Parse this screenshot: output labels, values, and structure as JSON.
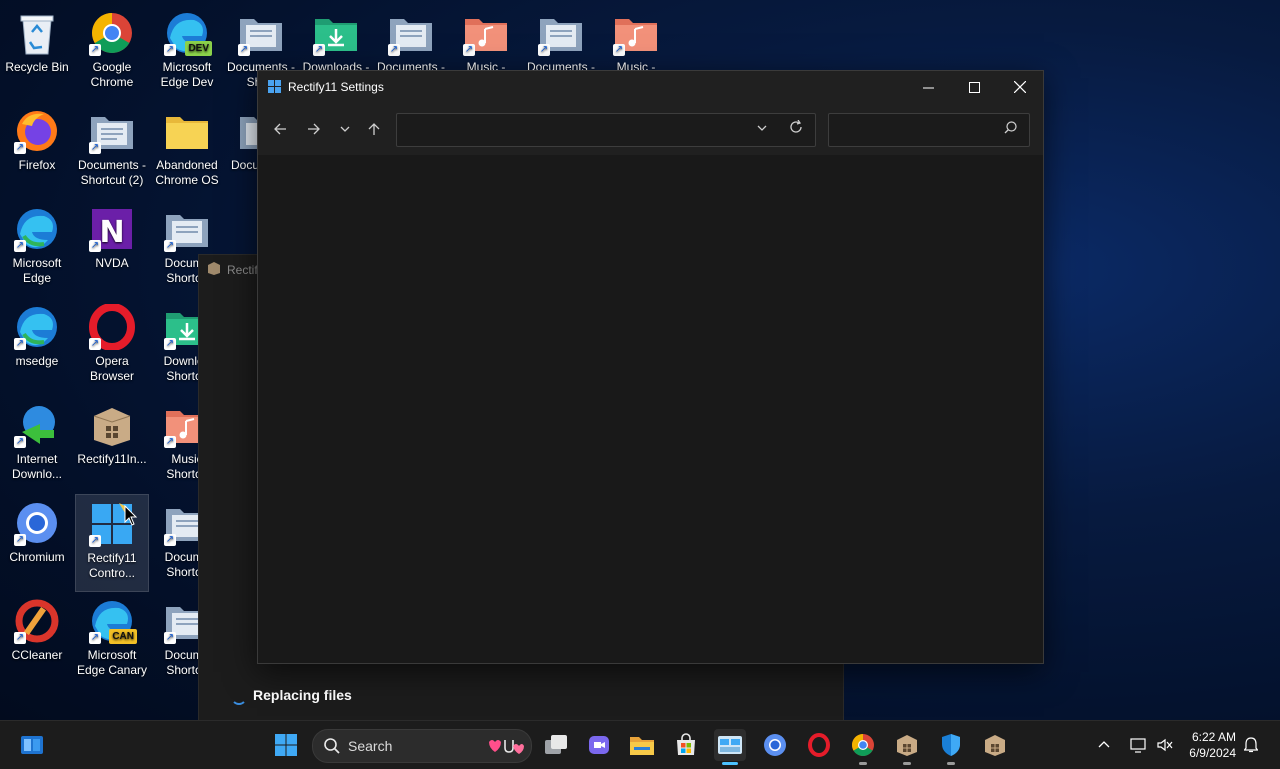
{
  "desktop": {
    "icons": [
      {
        "label": "Recycle Bin"
      },
      {
        "label": "Google Chrome"
      },
      {
        "label": "Microsoft Edge Dev",
        "badge": "DEV"
      },
      {
        "label": "Documents - Short"
      },
      {
        "label": "Downloads - Short"
      },
      {
        "label": "Documents - Short"
      },
      {
        "label": "Music -"
      },
      {
        "label": "Documents -"
      },
      {
        "label": "Music -"
      },
      {
        "label": "Firefox"
      },
      {
        "label": "Documents - Shortcut (2)"
      },
      {
        "label": "Abandoned Chrome OS"
      },
      {
        "label": "Docu Short"
      },
      {
        "label": "Microsoft Edge"
      },
      {
        "label": "NVDA"
      },
      {
        "label": "Docume Shortcu"
      },
      {
        "label": "msedge"
      },
      {
        "label": "Opera Browser"
      },
      {
        "label": "Downloa Shortcu"
      },
      {
        "label": "Internet Downlo..."
      },
      {
        "label": "Rectify11In..."
      },
      {
        "label": "Music Shortcu"
      },
      {
        "label": "Chromium"
      },
      {
        "label": "Rectify11 Contro..."
      },
      {
        "label": "Docume Shortcu"
      },
      {
        "label": "CCleaner"
      },
      {
        "label": "Microsoft Edge Canary",
        "badge": "CAN"
      },
      {
        "label": "Docume Shortcu"
      }
    ]
  },
  "background_window": {
    "title": "Rectif",
    "status": "Replacing files"
  },
  "window": {
    "title": "Rectify11 Settings",
    "address_value": "",
    "search_placeholder": ""
  },
  "taskbar": {
    "search_label": "Search",
    "time": "6:22 AM",
    "date": "6/9/2024"
  },
  "colors": {
    "accent": "#4cc2ff",
    "window_bg": "#191919",
    "taskbar_bg": "#1c1c1c"
  }
}
